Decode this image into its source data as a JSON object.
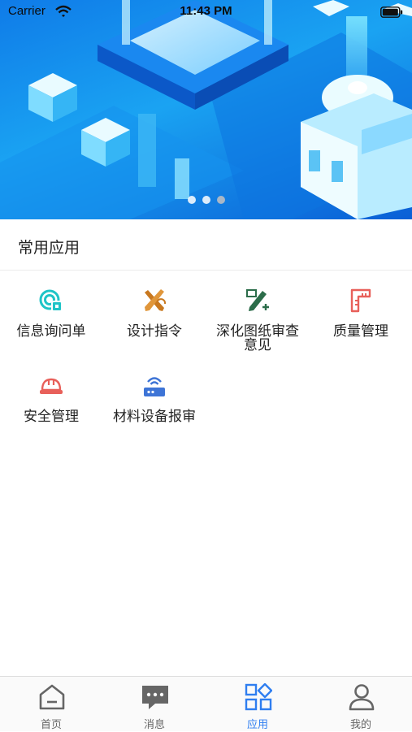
{
  "status_bar": {
    "carrier": "Carrier",
    "time": "11:43 PM"
  },
  "banner": {
    "dots": 3,
    "active_dot": 2
  },
  "section": {
    "title": "常用应用"
  },
  "apps": [
    {
      "label": "信息询问单",
      "icon": "info-inquiry-icon",
      "color": "#1fc4c7"
    },
    {
      "label": "设计指令",
      "icon": "design-tools-icon",
      "color": "#c8781f"
    },
    {
      "label": "深化图纸审查意见",
      "icon": "drawing-edit-icon",
      "color": "#2c6d4a"
    },
    {
      "label": "质量管理",
      "icon": "ruler-icon",
      "color": "#e8605a"
    },
    {
      "label": "安全管理",
      "icon": "helmet-icon",
      "color": "#e8605a"
    },
    {
      "label": "材料设备报审",
      "icon": "router-icon",
      "color": "#3d74d6"
    }
  ],
  "tabs": [
    {
      "label": "首页",
      "icon": "home-icon",
      "active": false
    },
    {
      "label": "消息",
      "icon": "message-icon",
      "active": false
    },
    {
      "label": "应用",
      "icon": "apps-icon",
      "active": true
    },
    {
      "label": "我的",
      "icon": "profile-icon",
      "active": false
    }
  ],
  "colors": {
    "accent": "#2f7ef0",
    "tab_inactive": "#666666"
  }
}
